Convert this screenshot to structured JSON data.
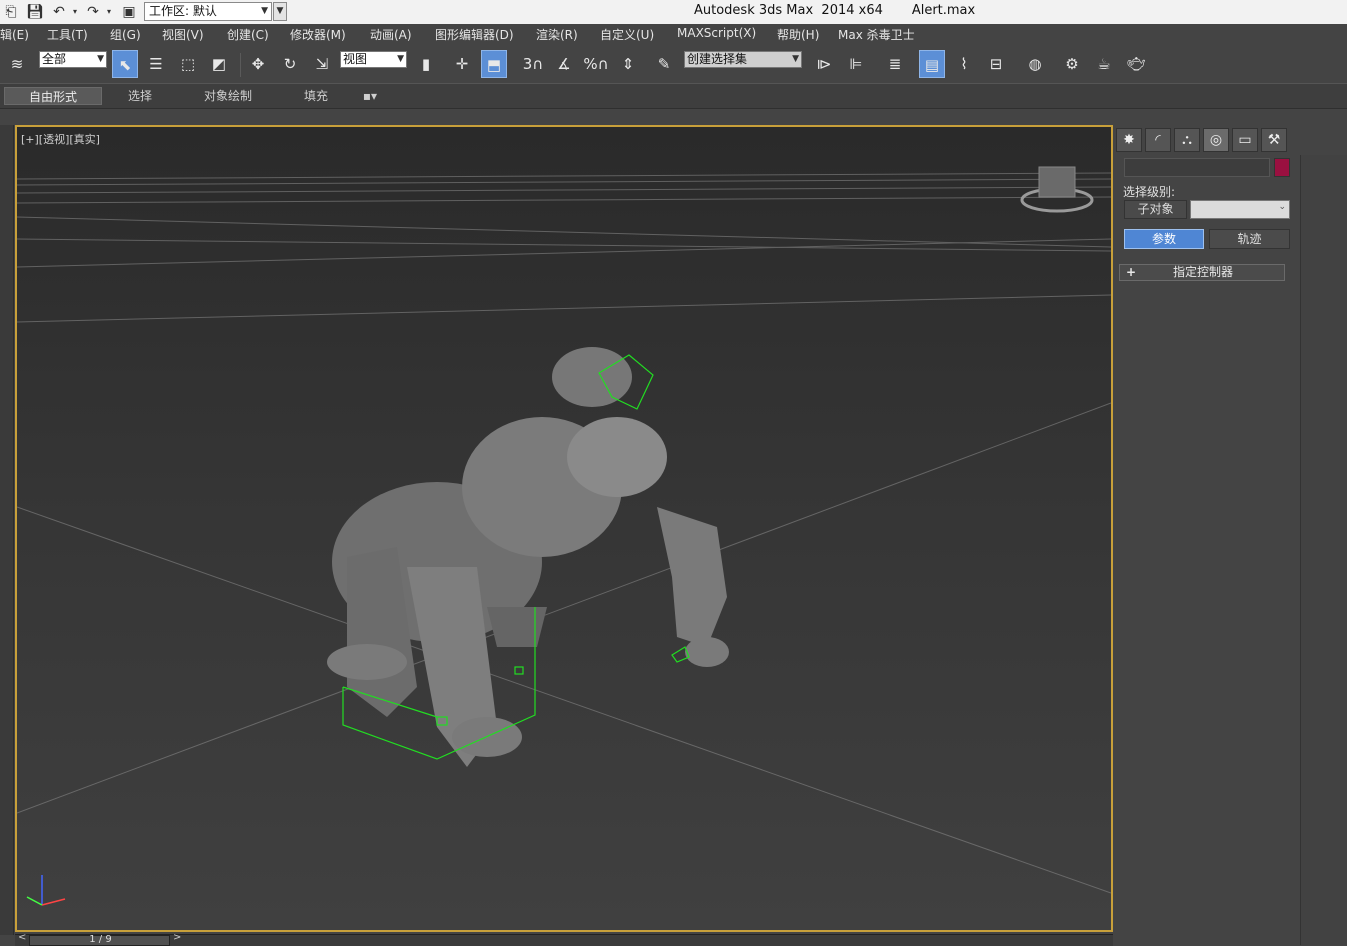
{
  "titlebar": {
    "title": "Autodesk 3ds Max  2014 x64       Alert.max",
    "workspace_label": "工作区: 默认",
    "quick_access_icons": [
      "app-menu-icon",
      "save-icon",
      "undo-icon",
      "redo-icon",
      "project-folder-icon"
    ]
  },
  "menubar": {
    "items": [
      "辑(E)",
      "工具(T)",
      "组(G)",
      "视图(V)",
      "创建(C)",
      "修改器(M)",
      "动画(A)",
      "图形编辑器(D)",
      "渲染(R)",
      "自定义(U)",
      "MAXScript(X)",
      "帮助(H)",
      "Max 杀毒卫士"
    ]
  },
  "toolbar": {
    "selection_filter": "全部",
    "reference_coord": "视图",
    "named_selection": "创建选择集",
    "snap_labels": {
      "snap3": "3",
      "percent": "%"
    }
  },
  "ribbon": {
    "tabs": [
      "自由形式",
      "选择",
      "对象绘制",
      "填充"
    ]
  },
  "viewport": {
    "label": "[+][透视][真实]",
    "border_color": "#c8a03a"
  },
  "command_panel": {
    "selection_level_label": "选择级别:",
    "subobject_button": "子对象",
    "params_button": "参数",
    "track_button": "轨迹",
    "rollout_plus": "+",
    "rollout_label": "指定控制器",
    "object_color": "#9a1040",
    "tabs": [
      "create-icon",
      "modify-icon",
      "hierarchy-icon",
      "motion-icon",
      "display-icon",
      "utilities-icon"
    ]
  },
  "timeline": {
    "frame": "1 / 9",
    "prev": "<",
    "next": ">"
  }
}
